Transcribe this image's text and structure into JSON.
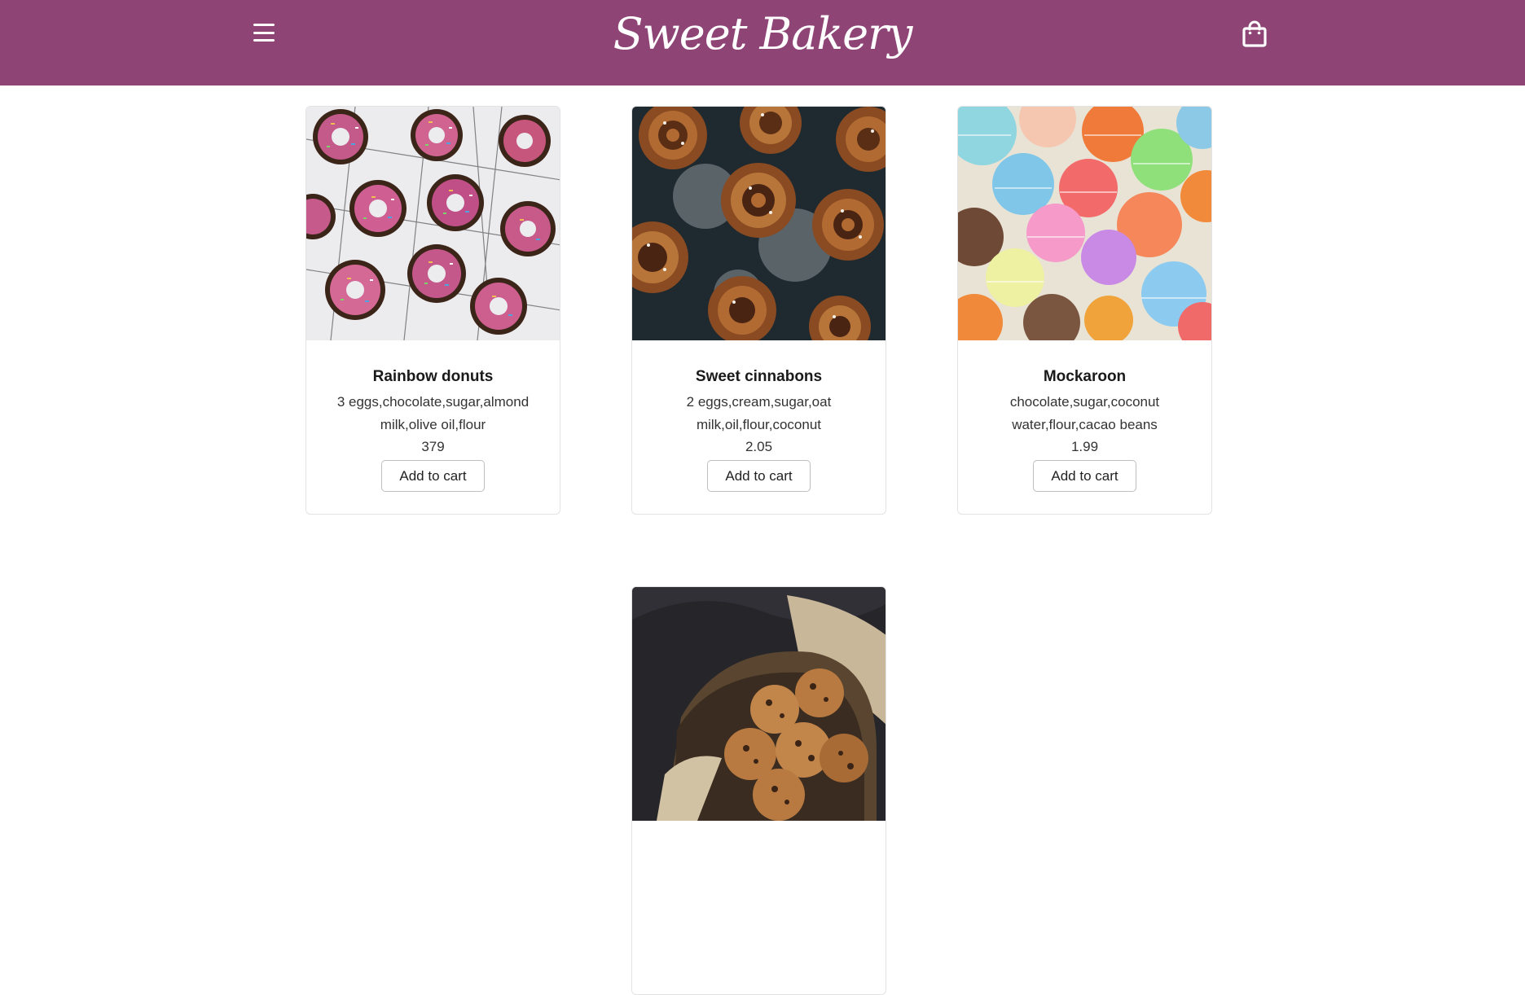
{
  "header": {
    "brand": "Sweet Bakery",
    "menu_icon": "hamburger-menu-icon",
    "cart_icon": "shopping-bag-icon",
    "background_color": "#8e4475",
    "text_color": "#ffffff"
  },
  "products": [
    {
      "name": "Rainbow donuts",
      "ingredients": "3 eggs,chocolate,sugar,almond milk,olive oil,flour",
      "price": "379",
      "button_label": "Add to cart",
      "image": "rainbow-donuts-photo"
    },
    {
      "name": "Sweet cinnabons",
      "ingredients": "2 eggs,cream,sugar,oat milk,oil,flour,coconut",
      "price": "2.05",
      "button_label": "Add to cart",
      "image": "cinnamon-rolls-photo"
    },
    {
      "name": "Mockaroon",
      "ingredients": "chocolate,sugar,coconut water,flour,cacao beans",
      "price": "1.99",
      "button_label": "Add to cart",
      "image": "macarons-photo"
    },
    {
      "image": "cookies-photo"
    }
  ]
}
